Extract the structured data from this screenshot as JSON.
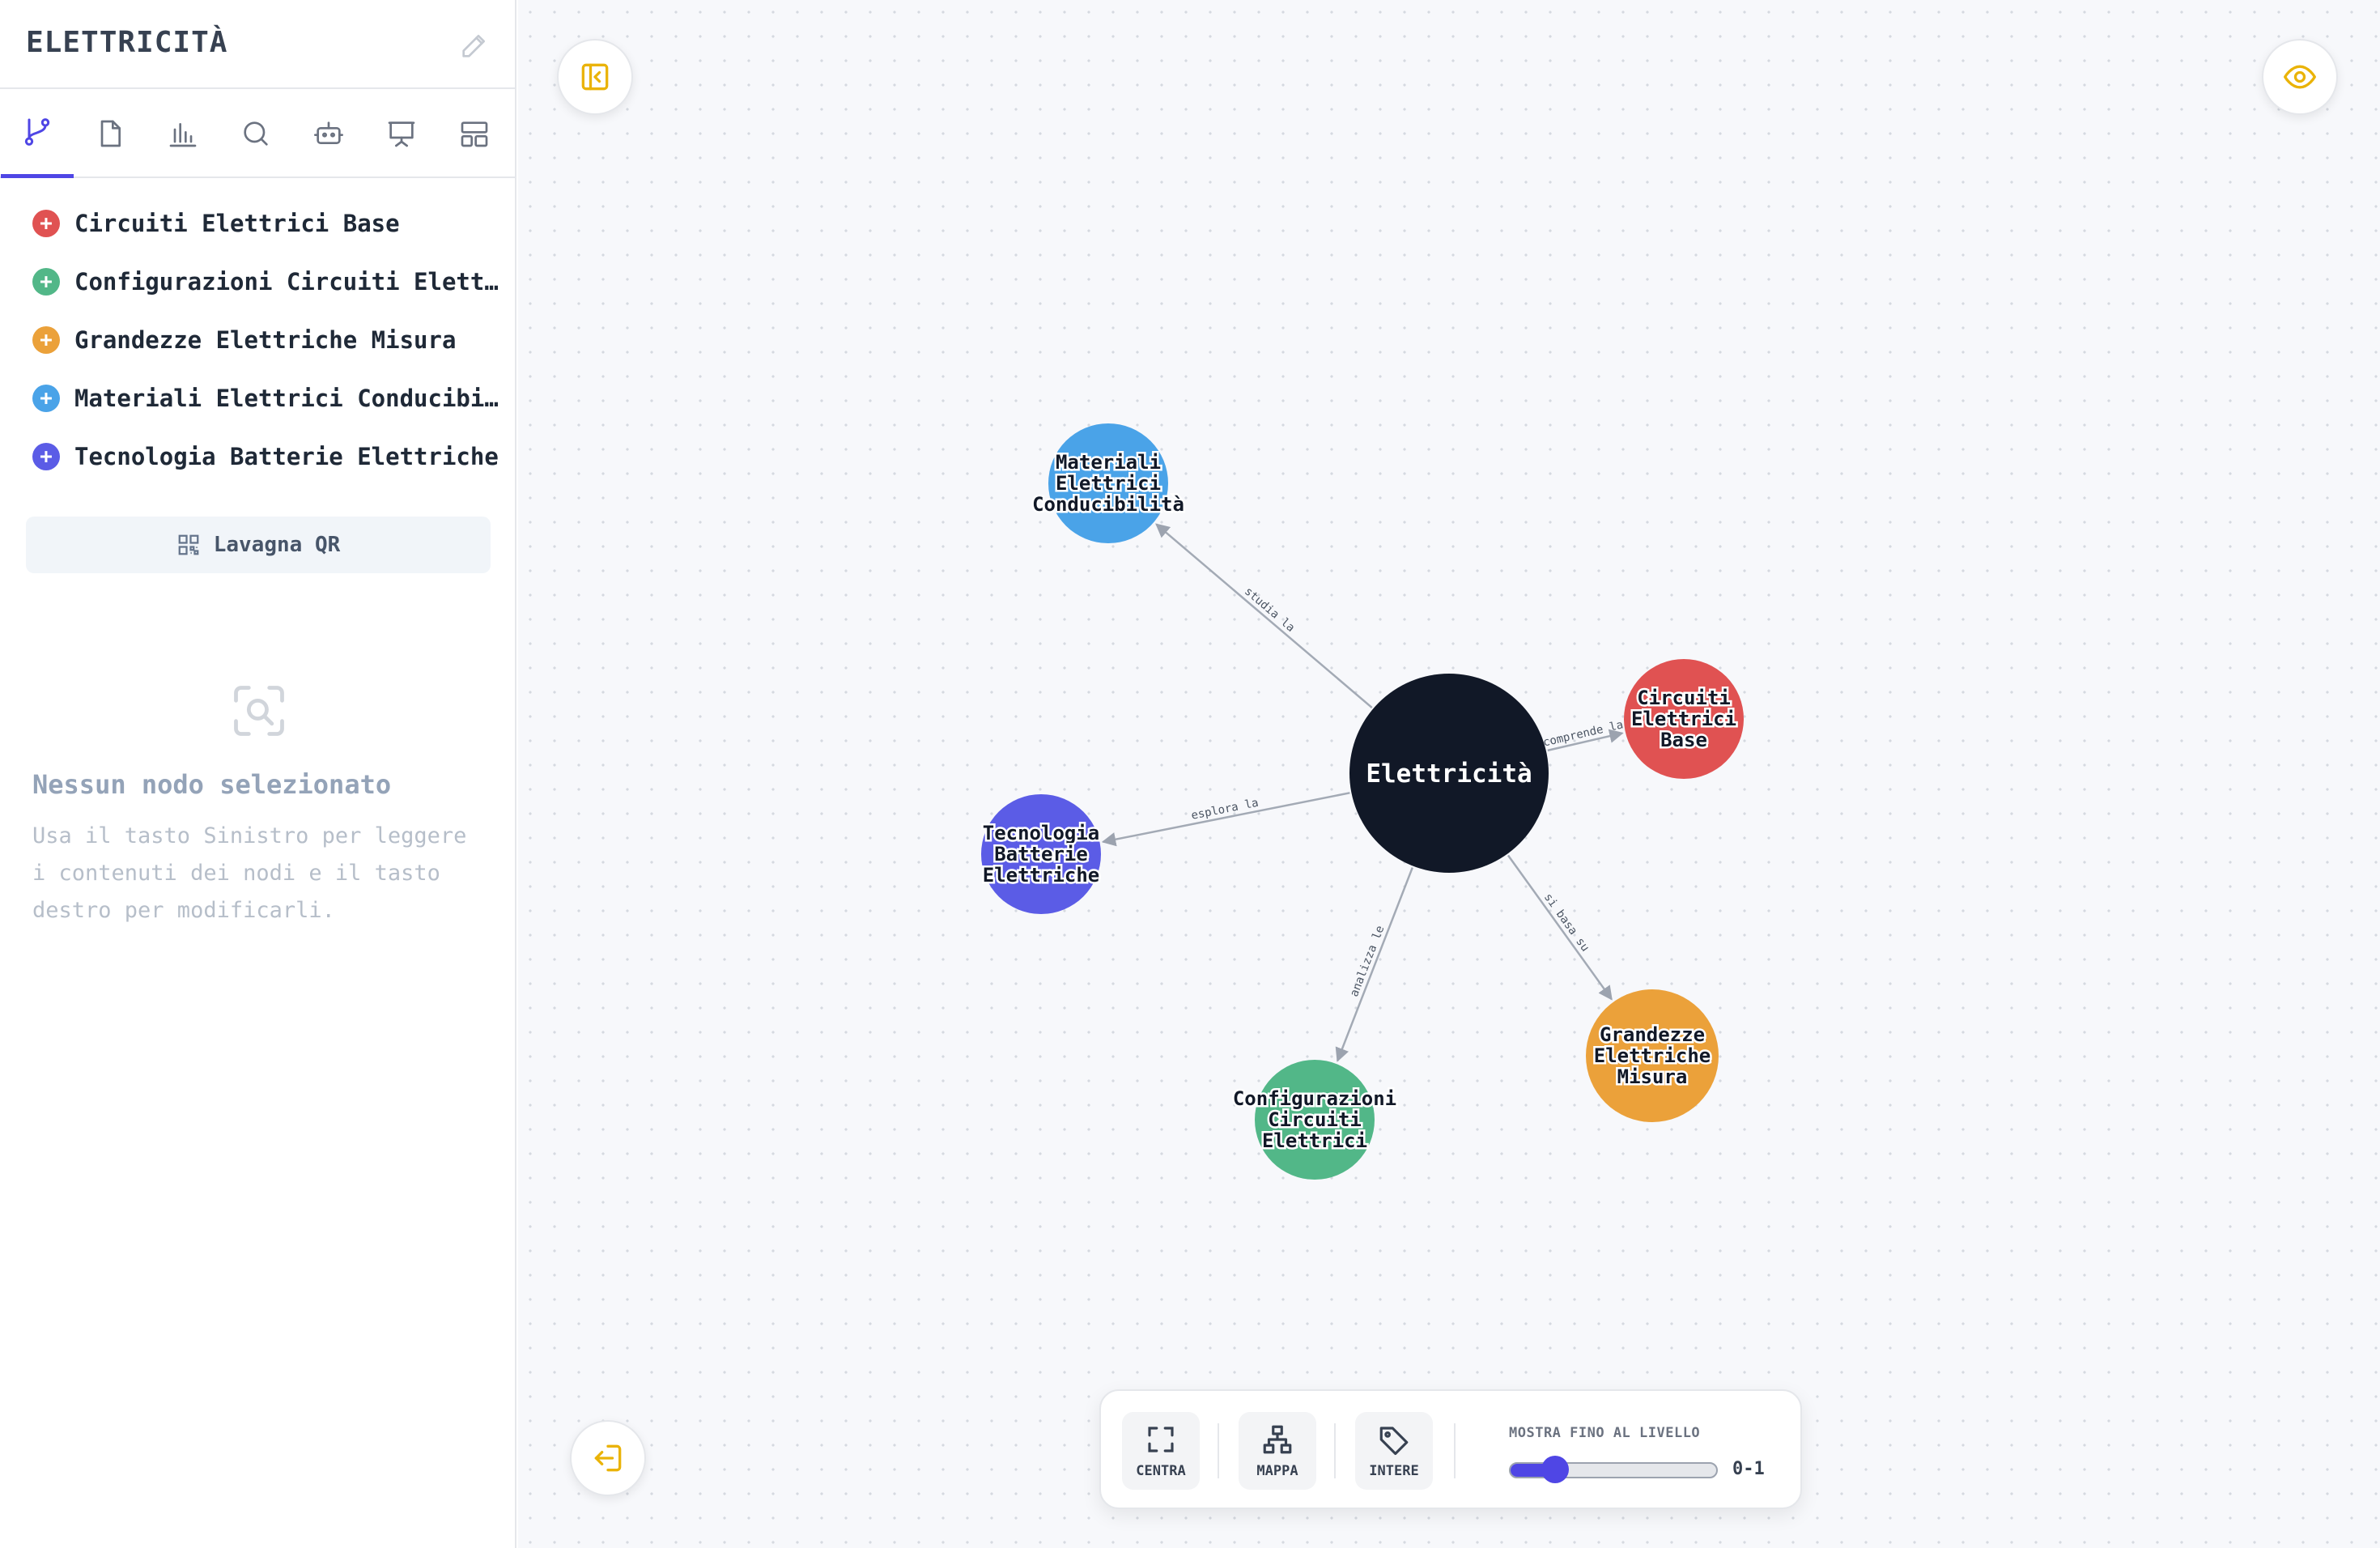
{
  "sidebar": {
    "title": "ELETTRICITÀ",
    "items": [
      {
        "label": "Circuiti Elettrici Base",
        "color": "#e05252"
      },
      {
        "label": "Configurazioni Circuiti Elettrici",
        "color": "#52b788"
      },
      {
        "label": "Grandezze Elettriche Misura",
        "color": "#eba13a"
      },
      {
        "label": "Materiali Elettrici Conducibilità",
        "color": "#4aa3e8"
      },
      {
        "label": "Tecnologia Batterie Elettriche",
        "color": "#5b5ce6"
      }
    ],
    "qr_button": "Lavagna QR",
    "empty_title": "Nessun nodo selezionato",
    "empty_desc": "Usa il tasto Sinistro per leggere i contenuti dei nodi e il tasto destro per modificarli."
  },
  "graph": {
    "center": {
      "label": "Elettricità",
      "color": "#111827"
    },
    "nodes": [
      {
        "lines": [
          "Materiali",
          "Elettrici",
          "Conducibilità"
        ],
        "color": "#4aa3e8",
        "edge": "studia la"
      },
      {
        "lines": [
          "Circuiti",
          "Elettrici",
          "Base"
        ],
        "color": "#e05252",
        "edge": "comprende la"
      },
      {
        "lines": [
          "Tecnologia",
          "Batterie",
          "Elettriche"
        ],
        "color": "#5b5ce6",
        "edge": "esplora la"
      },
      {
        "lines": [
          "Configurazioni",
          "Circuiti",
          "Elettrici"
        ],
        "color": "#52b788",
        "edge": "analizza le"
      },
      {
        "lines": [
          "Grandezze",
          "Elettriche",
          "Misura"
        ],
        "color": "#eba13a",
        "edge": "si basa su"
      }
    ]
  },
  "toolbar": {
    "center_label": "CENTRA",
    "map_label": "MAPPA",
    "whole_label": "INTERE",
    "level_label": "MOSTRA FINO AL LIVELLO",
    "level_value": "0-1",
    "level_fraction": 0.22
  },
  "colors": {
    "accent": "#4f46e5",
    "button_icon": "#eab308"
  }
}
